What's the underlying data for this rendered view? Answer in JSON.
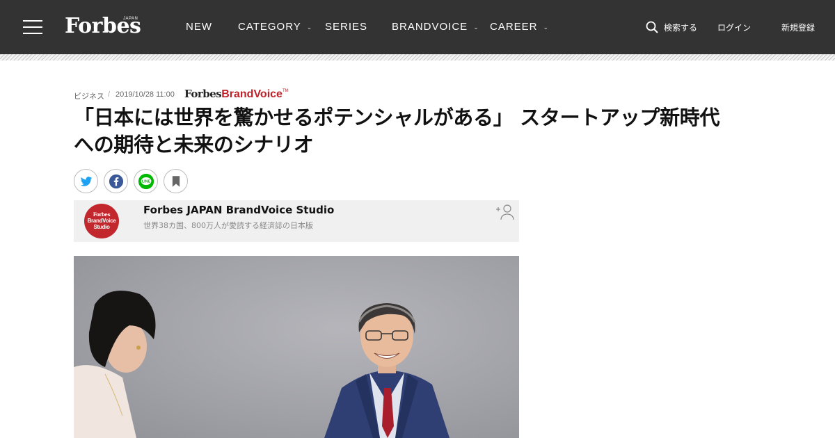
{
  "header": {
    "logo": "Forbes",
    "logo_sub": "JAPAN",
    "nav": {
      "new": "NEW",
      "category": "CATEGORY",
      "series": "SERIES",
      "brandvoice": "BRANDVOICE",
      "career": "CAREER"
    },
    "search_label": "検索する",
    "login_label": "ログイン",
    "signup_label": "新規登録"
  },
  "article": {
    "category": "ビジネス",
    "separator": "/",
    "date": "2019/10/28 11:00",
    "sponsor_logo": {
      "forbes": "Forbes",
      "brand": "BrandVoice",
      "tm": "TM"
    },
    "title": "「日本には世界を驚かせるポテンシャルがある」 スタートアップ新時代への期待と未来のシナリオ"
  },
  "share": {
    "icons": [
      "twitter-icon",
      "facebook-icon",
      "line-icon",
      "bookmark-icon"
    ],
    "line_text": "LINE"
  },
  "author": {
    "avatar_lines": [
      "Forbes",
      "BrandVoice",
      "Studio"
    ],
    "name": "Forbes JAPAN BrandVoice Studio",
    "description": "世界38カ国、800万人が愛読する経済誌の日本版"
  },
  "colors": {
    "header_bg": "#333333",
    "brand_red": "#c0202a",
    "twitter": "#1da1f2",
    "facebook": "#3b5998",
    "line": "#00b900"
  }
}
